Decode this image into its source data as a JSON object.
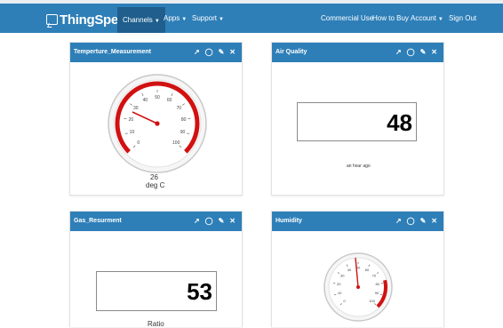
{
  "nav": {
    "brand": "ThingSpeak",
    "brand_tm": "™",
    "channels": "Channels",
    "apps": "Apps",
    "support": "Support",
    "commercial_use": "Commercial Use",
    "how_to_buy": "How to Buy",
    "account": "Account",
    "sign_out": "Sign Out"
  },
  "widgets": [
    {
      "title": "Temperture_Measurement",
      "type": "gauge",
      "value": "26",
      "unit": "deg C",
      "ticks": [
        "0",
        "10",
        "20",
        "30",
        "40",
        "50",
        "60",
        "70",
        "80",
        "90",
        "100"
      ]
    },
    {
      "title": "Air Quality",
      "type": "numeric",
      "value": "48",
      "caption": "an hour ago"
    },
    {
      "title": "Gas_Resurment",
      "type": "numeric",
      "value": "53",
      "caption": "Ratio"
    },
    {
      "title": "Humidity",
      "type": "gauge",
      "ticks": [
        "0",
        "10",
        "20",
        "30",
        "40",
        "50",
        "60",
        "70",
        "80",
        "90",
        "100"
      ]
    }
  ],
  "icons": {
    "popout": "external-link-icon",
    "comment": "comment-icon",
    "edit": "pencil-icon",
    "close": "close-icon"
  },
  "colors": {
    "header_blue": "#2e7fb8",
    "gauge_red": "#d11111"
  }
}
